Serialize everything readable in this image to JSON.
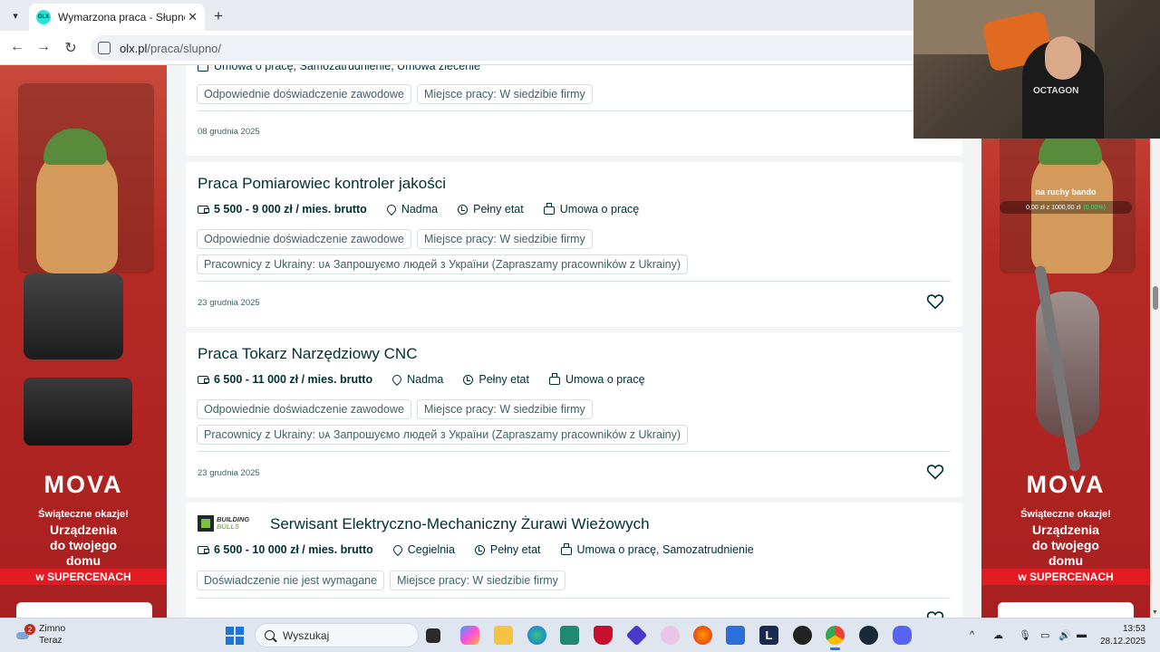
{
  "browser": {
    "tab_title": "Wymarzona praca - Słupno - sp",
    "favicon_text": "OLX",
    "url_host": "olx.pl",
    "url_path": "/praca/slupno/"
  },
  "top_partial": {
    "meta_text": "Umowa o pracę, Samozatrudnienie, Umowa zlecenie",
    "chips": [
      "Odpowiednie doświadczenie zawodowe",
      "Miejsce pracy: W siedzibie firmy"
    ],
    "date": "08 grudnia 2025"
  },
  "listings": [
    {
      "title": "Praca Pomiarowiec kontroler jakości",
      "salary": "5 500 - 9 000 zł / mies. brutto",
      "location": "Nadma",
      "hours": "Pełny etat",
      "contract": "Umowa o pracę",
      "chips": [
        "Odpowiednie doświadczenie zawodowe",
        "Miejsce pracy: W siedzibie firmy"
      ],
      "chip_extra": "Pracownicy z Ukrainy: ᴜᴀ Запрошуємо людей з України (Zapraszamy pracowników z Ukrainy)",
      "date": "23 grudnia 2025"
    },
    {
      "title": "Praca Tokarz Narzędziowy CNC",
      "salary": "6 500 - 11 000 zł / mies. brutto",
      "location": "Nadma",
      "hours": "Pełny etat",
      "contract": "Umowa o pracę",
      "chips": [
        "Odpowiednie doświadczenie zawodowe",
        "Miejsce pracy: W siedzibie firmy"
      ],
      "chip_extra": "Pracownicy z Ukrainy: ᴜᴀ Запрошуємо людей з України (Zapraszamy pracowników z Ukrainy)",
      "date": "23 grudnia 2025"
    },
    {
      "title": "Serwisant Elektryczno-Mechaniczny Żurawi Wieżowych",
      "logo_line1": "BUILDING",
      "logo_line2": "BULLS",
      "salary": "6 500 - 10 000 zł / mies. brutto",
      "location": "Cegielnia",
      "hours": "Pełny etat",
      "contract": "Umowa o pracę, Samozatrudnienie",
      "chips": [
        "Doświadczenie nie jest wymagane",
        "Miejsce pracy: W siedzibie firmy"
      ]
    }
  ],
  "ads": {
    "brand": "MOVA",
    "subtitle": "Świąteczne okazje!",
    "main_line1": "Urządzenia",
    "main_line2": "do twojego",
    "main_line3": "domu",
    "badge": "w SUPERCENACH",
    "overlay_title": "na ruchy bando",
    "overlay_amount": "0,00 zł z 1000,00 zł",
    "overlay_percent": "(0.00%)"
  },
  "webcam": {
    "shirt_text": "OCTAGON"
  },
  "taskbar": {
    "weather_count": "2",
    "weather_title": "Zimno",
    "weather_sub": "Teraz",
    "search_placeholder": "Wyszukaj",
    "time": "13:53",
    "date": "28.12.2025"
  }
}
